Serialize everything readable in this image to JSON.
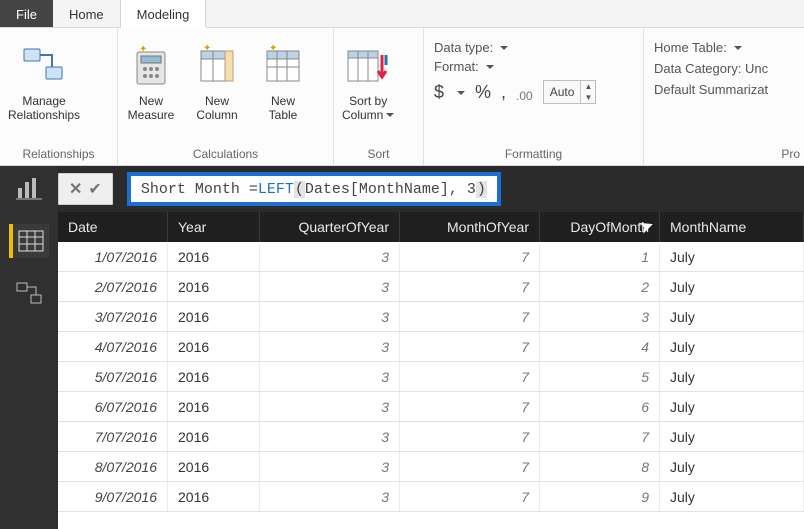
{
  "tabs": {
    "file": "File",
    "home": "Home",
    "modeling": "Modeling"
  },
  "ribbon": {
    "relationships": {
      "manage": "Manage\nRelationships",
      "caption": "Relationships"
    },
    "calculations": {
      "newMeasure": "New\nMeasure",
      "newColumn": "New\nColumn",
      "newTable": "New\nTable",
      "caption": "Calculations"
    },
    "sort": {
      "sortBy": "Sort by\nColumn",
      "caption": "Sort"
    },
    "formatting": {
      "dataType": "Data type:",
      "format": "Format:",
      "dollar": "$",
      "percent": "%",
      "comma": ",",
      "decimals": ".00",
      "auto": "Auto",
      "caption": "Formatting"
    },
    "properties": {
      "homeTable": "Home Table:",
      "dataCategory": "Data Category: Unc",
      "defaultSumm": "Default Summarizat",
      "caption": "Pro"
    }
  },
  "formula": {
    "prefix": "Short Month = ",
    "func": "LEFT",
    "argText": " Dates[MonthName], 3 "
  },
  "grid": {
    "headers": [
      "Date",
      "Year",
      "QuarterOfYear",
      "MonthOfYear",
      "DayOfMonth",
      "MonthName"
    ],
    "rows": [
      {
        "date": "1/07/2016",
        "year": "2016",
        "q": "3",
        "m": "7",
        "d": "1",
        "mn": "July"
      },
      {
        "date": "2/07/2016",
        "year": "2016",
        "q": "3",
        "m": "7",
        "d": "2",
        "mn": "July"
      },
      {
        "date": "3/07/2016",
        "year": "2016",
        "q": "3",
        "m": "7",
        "d": "3",
        "mn": "July"
      },
      {
        "date": "4/07/2016",
        "year": "2016",
        "q": "3",
        "m": "7",
        "d": "4",
        "mn": "July"
      },
      {
        "date": "5/07/2016",
        "year": "2016",
        "q": "3",
        "m": "7",
        "d": "5",
        "mn": "July"
      },
      {
        "date": "6/07/2016",
        "year": "2016",
        "q": "3",
        "m": "7",
        "d": "6",
        "mn": "July"
      },
      {
        "date": "7/07/2016",
        "year": "2016",
        "q": "3",
        "m": "7",
        "d": "7",
        "mn": "July"
      },
      {
        "date": "8/07/2016",
        "year": "2016",
        "q": "3",
        "m": "7",
        "d": "8",
        "mn": "July"
      },
      {
        "date": "9/07/2016",
        "year": "2016",
        "q": "3",
        "m": "7",
        "d": "9",
        "mn": "July"
      }
    ]
  }
}
